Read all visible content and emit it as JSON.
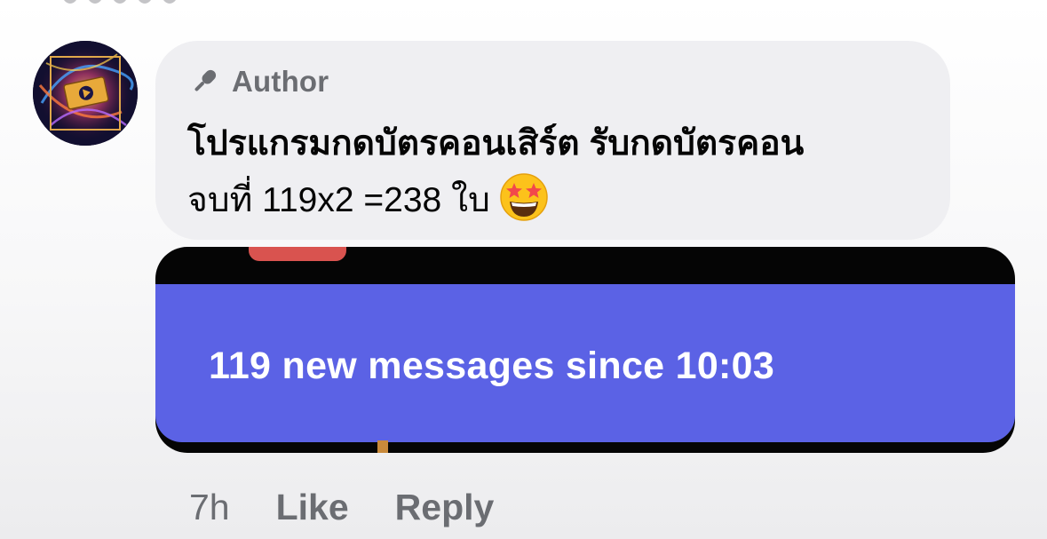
{
  "comment": {
    "author_badge": "Author",
    "text_line1": "โปรแกรมกดบัตรคอนเสิร์ต รับกดบัตรคอน",
    "text_line2": "จบที่ 119x2 =238 ใบ",
    "emoji": "star-struck"
  },
  "attachment": {
    "banner_text": "119 new messages since 10:03",
    "banner_color": "#5B62E5"
  },
  "actions": {
    "time": "7h",
    "like_label": "Like",
    "reply_label": "Reply"
  },
  "icons": {
    "author": "microphone-icon",
    "emoji": "star-struck-emoji-icon"
  }
}
